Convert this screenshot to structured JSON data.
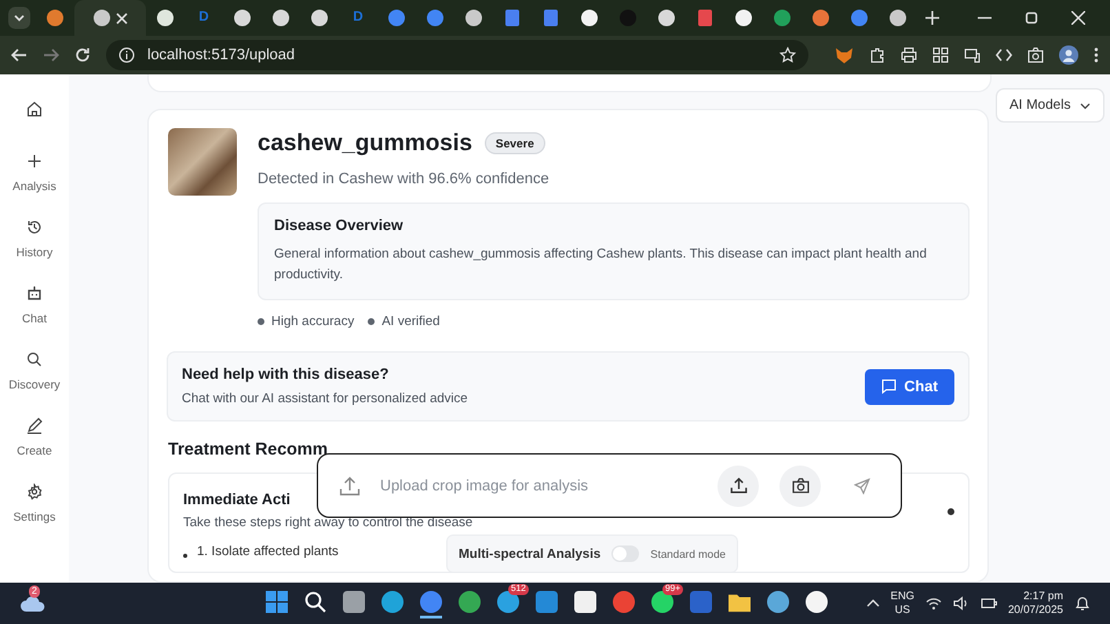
{
  "browser": {
    "tabs": [
      {
        "selected": false,
        "kind": "round",
        "color": "#e07a2e"
      },
      {
        "selected": true,
        "kind": "round",
        "color": "#c9c9c9"
      },
      {
        "selected": false,
        "kind": "round",
        "color": "#dfe6dd"
      },
      {
        "selected": false,
        "kind": "letter",
        "color": "#1d6fd6",
        "letter": "D"
      },
      {
        "selected": false,
        "kind": "round",
        "color": "#d8d8d8"
      },
      {
        "selected": false,
        "kind": "round",
        "color": "#d8d8d8"
      },
      {
        "selected": false,
        "kind": "round",
        "color": "#d8d8d8"
      },
      {
        "selected": false,
        "kind": "letter",
        "color": "#1d6fd6",
        "letter": "D"
      },
      {
        "selected": false,
        "kind": "round",
        "color": "#4285f4"
      },
      {
        "selected": false,
        "kind": "round",
        "color": "#4285f4"
      },
      {
        "selected": false,
        "kind": "round",
        "color": "#c9c9c9"
      },
      {
        "selected": false,
        "kind": "square",
        "color": "#4a7ff0"
      },
      {
        "selected": false,
        "kind": "square",
        "color": "#4a7ff0"
      },
      {
        "selected": false,
        "kind": "round",
        "color": "#f2f2f2"
      },
      {
        "selected": false,
        "kind": "round",
        "color": "#111111"
      },
      {
        "selected": false,
        "kind": "round",
        "color": "#d8d8d8"
      },
      {
        "selected": false,
        "kind": "square",
        "color": "#e5484d"
      },
      {
        "selected": false,
        "kind": "round",
        "color": "#f2f2f2"
      },
      {
        "selected": false,
        "kind": "round",
        "color": "#21a05b"
      },
      {
        "selected": false,
        "kind": "round",
        "color": "#e8733a"
      },
      {
        "selected": false,
        "kind": "round",
        "color": "#4285f4"
      },
      {
        "selected": false,
        "kind": "round",
        "color": "#c9c9c9"
      }
    ],
    "url": "localhost:5173/upload"
  },
  "sidebar": {
    "items": [
      {
        "kind": "home"
      },
      {
        "kind": "add",
        "label": "Analysis"
      },
      {
        "kind": "history",
        "label": "History"
      },
      {
        "kind": "bot",
        "label": "Chat"
      },
      {
        "kind": "search",
        "label": "Discovery"
      },
      {
        "kind": "pen",
        "label": "Create"
      },
      {
        "kind": "gear",
        "label": "Settings"
      }
    ]
  },
  "model_menu": {
    "label": "AI Models"
  },
  "result": {
    "title": "cashew_gummosis",
    "severity": "Severe",
    "subtitle": "Detected in Cashew with 96.6% confidence",
    "overview": {
      "heading": "Disease Overview",
      "text": "General information about cashew_gummosis affecting Cashew plants. This disease can impact plant health and productivity."
    },
    "tags": [
      "High accuracy",
      "AI verified"
    ]
  },
  "help": {
    "heading": "Need help with this disease?",
    "text": "Chat with our AI assistant for personalized advice",
    "button": "Chat"
  },
  "treatment": {
    "heading": "Treatment Recomm",
    "card": {
      "heading": "Immediate Acti",
      "text": "Take these steps right away to control the disease",
      "steps": [
        "1. Isolate affected plants"
      ]
    }
  },
  "upload_bar": {
    "placeholder": "Upload crop image for analysis"
  },
  "mode": {
    "label": "Multi-spectral Analysis",
    "on": false,
    "state_text": "Standard mode"
  },
  "taskbar": {
    "weather_badge": "2",
    "apps": [
      {
        "kind": "windows",
        "color": "#3a9bf0",
        "selected": false
      },
      {
        "kind": "search",
        "color": "#ffffff",
        "selected": false
      },
      {
        "kind": "square",
        "color": "#9aa0a6",
        "selected": false
      },
      {
        "kind": "round",
        "color": "#1fa3d8",
        "selected": false
      },
      {
        "kind": "round",
        "color": "#4285f4",
        "selected": true
      },
      {
        "kind": "round",
        "color": "#34a853",
        "selected": false
      },
      {
        "kind": "round",
        "color": "#2aa1e0",
        "badge": "512",
        "selected": false
      },
      {
        "kind": "square",
        "color": "#2489d6",
        "selected": false
      },
      {
        "kind": "square",
        "color": "#f0f0f0",
        "selected": false
      },
      {
        "kind": "round",
        "color": "#ea4335",
        "selected": false
      },
      {
        "kind": "round",
        "color": "#25d366",
        "badge": "99+",
        "selected": false
      },
      {
        "kind": "square",
        "color": "#2b62c9",
        "selected": false
      },
      {
        "kind": "folder",
        "color": "#f2c243",
        "selected": false
      },
      {
        "kind": "round",
        "color": "#5aa7d8",
        "selected": false
      },
      {
        "kind": "round",
        "color": "#f4f4f4",
        "selected": false
      }
    ],
    "language": "ENG",
    "region": "US",
    "time": "2:17 pm",
    "date": "20/07/2025"
  }
}
